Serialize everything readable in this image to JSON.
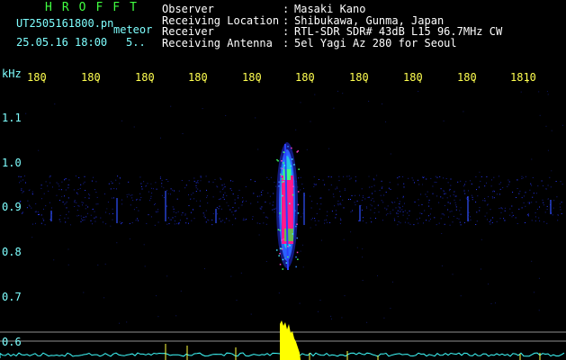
{
  "header": {
    "station_name": "HROFFT",
    "filename": "UT2505161800.pn",
    "type_label": "meteor",
    "datetime": "25.05.16 18:00",
    "count": "5..",
    "info": [
      {
        "key": "Observer",
        "sep": ":",
        "value": "Masaki Kano"
      },
      {
        "key": "Receiving Location",
        "sep": ":",
        "value": "Shibukawa, Gunma, Japan"
      },
      {
        "key": "Receiver",
        "sep": ":",
        "value": "RTL-SDR SDR# 43dB L15 96.7MHz CW"
      },
      {
        "key": "Receiving Antenna",
        "sep": ":",
        "value": "5el Yagi Az 280 for Seoul"
      }
    ]
  },
  "colors": {
    "background": "#000000",
    "time_labels": "#ffff50",
    "freq_labels": "#7fffff",
    "station": "#40ff40",
    "meteor_core": "#ff1a8c",
    "meteor_edge": "#2040ff",
    "echo_power": "#ffff00",
    "noise_floor": "#40ffff"
  },
  "chart_data": {
    "type": "heatmap",
    "freq_unit_label": "kHz",
    "freq_ticks": [
      "1.1",
      "1.0",
      "0.9",
      "0.8",
      "0.7",
      "0.6"
    ],
    "time_ticks": [
      "180",
      "180",
      "180",
      "180",
      "180",
      "180",
      "180",
      "180",
      "180",
      "1810"
    ],
    "signals": [
      {
        "kind": "meteor_echo",
        "time_min": 18.05,
        "freq_khz": [
          0.78,
          1.04
        ],
        "peak_freq_khz": 0.9
      }
    ]
  }
}
